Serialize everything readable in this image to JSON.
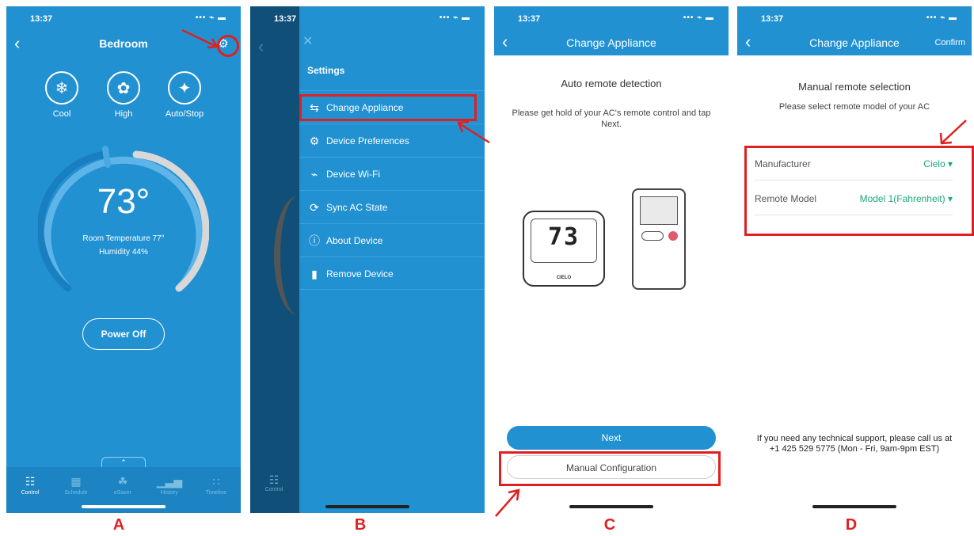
{
  "status": {
    "time": "13:37",
    "icons": "••• ⌁ ▬"
  },
  "panelA": {
    "title": "Bedroom",
    "modes": [
      {
        "label": "Cool",
        "icon": "snowflake-icon",
        "glyph": "❄"
      },
      {
        "label": "High",
        "icon": "fan-icon",
        "glyph": "✿"
      },
      {
        "label": "Auto/Stop",
        "icon": "swing-icon",
        "glyph": "✦"
      }
    ],
    "setpoint": "73°",
    "setpoint_value": 73,
    "room_temp": "Room Temperature 77°",
    "humidity": "Humidity 44%",
    "power_button": "Power Off",
    "tabs": [
      {
        "label": "Control",
        "icon": "sliders-icon",
        "glyph": "☷"
      },
      {
        "label": "Schedule",
        "icon": "calendar-icon",
        "glyph": "▦"
      },
      {
        "label": "eSaver",
        "icon": "leaf-icon",
        "glyph": "☘"
      },
      {
        "label": "History",
        "icon": "bar-chart-icon",
        "glyph": "▁▃▅"
      },
      {
        "label": "Timeline",
        "icon": "timeline-icon",
        "glyph": "∷"
      }
    ],
    "letter": "A"
  },
  "panelB": {
    "heading": "Settings",
    "items": [
      {
        "label": "Change Appliance",
        "icon": "swap-arrows-icon",
        "glyph": "⇆"
      },
      {
        "label": "Device Preferences",
        "icon": "gears-icon",
        "glyph": "⚙"
      },
      {
        "label": "Device Wi-Fi",
        "icon": "wifi-icon",
        "glyph": "⌁"
      },
      {
        "label": "Sync AC State",
        "icon": "sync-icon",
        "glyph": "⟳"
      },
      {
        "label": "About Device",
        "icon": "info-icon",
        "glyph": "ⓘ"
      },
      {
        "label": "Remove Device",
        "icon": "trash-icon",
        "glyph": "▮"
      }
    ],
    "tab_label": "Control",
    "letter": "B"
  },
  "panelC": {
    "title": "Change Appliance",
    "heading": "Auto remote detection",
    "instructions": "Please get hold of your AC's remote control and tap Next.",
    "remote_display": "73",
    "remote_brand": "CIELO",
    "next_button": "Next",
    "manual_button": "Manual Configuration",
    "letter": "C"
  },
  "panelD": {
    "title": "Change Appliance",
    "confirm": "Confirm",
    "heading": "Manual remote selection",
    "subheading": "Please select remote model of your AC",
    "manufacturer_label": "Manufacturer",
    "manufacturer_value": "Cielo ▾",
    "model_label": "Remote Model",
    "model_value": "Model 1(Fahrenheit) ▾",
    "support": "If you need any technical support, please call us at +1 425 529 5775 (Mon - Fri, 9am-9pm EST)",
    "letter": "D"
  },
  "colors": {
    "primary": "#2191d2",
    "annotation": "#e02020",
    "accent_green": "#1ea77e"
  }
}
